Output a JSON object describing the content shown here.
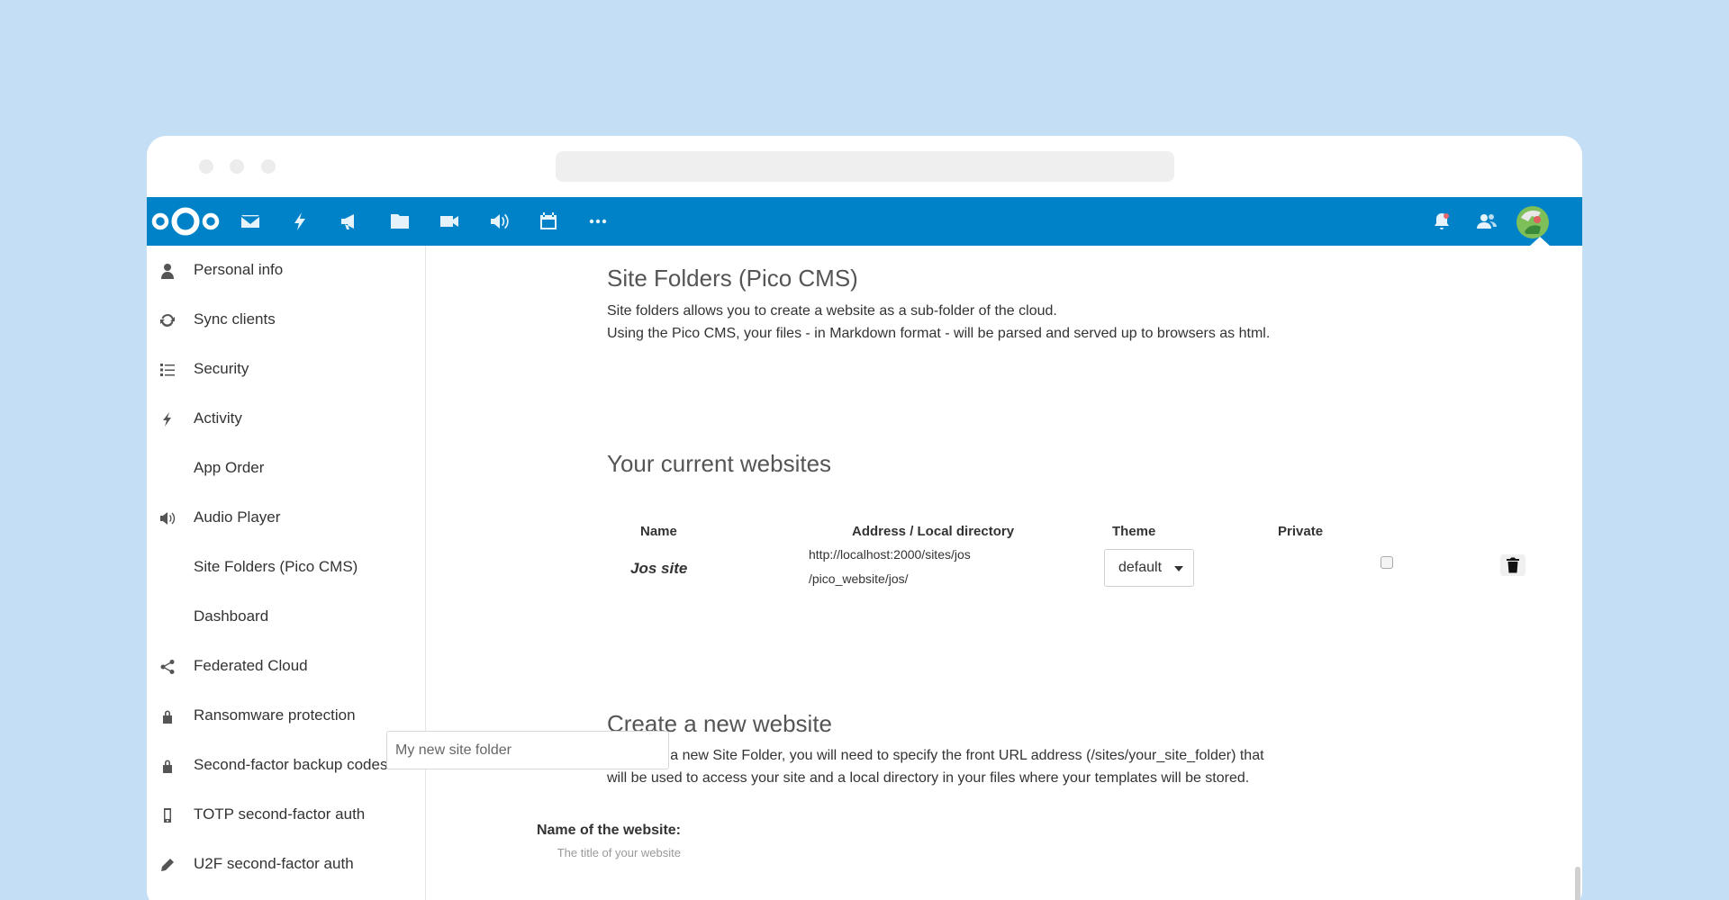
{
  "topbar": {
    "nav_icons": [
      "mail-icon",
      "lightning-icon",
      "megaphone-icon",
      "folder-icon",
      "video-icon",
      "speaker-icon",
      "calendar-icon",
      "more-icon"
    ],
    "right_icons": [
      "bell-icon",
      "contacts-icon",
      "avatar"
    ],
    "color": "#0082c9"
  },
  "sidebar": {
    "items": [
      {
        "label": "Personal info",
        "icon": "person-icon"
      },
      {
        "label": "Sync clients",
        "icon": "sync-icon"
      },
      {
        "label": "Security",
        "icon": "list-icon"
      },
      {
        "label": "Activity",
        "icon": "lightning-icon"
      },
      {
        "label": "App Order",
        "icon": ""
      },
      {
        "label": "Audio Player",
        "icon": "speaker-icon"
      },
      {
        "label": "Site Folders (Pico CMS)",
        "icon": ""
      },
      {
        "label": "Dashboard",
        "icon": ""
      },
      {
        "label": "Federated Cloud",
        "icon": "share-icon"
      },
      {
        "label": "Ransomware protection",
        "icon": "lock-icon"
      },
      {
        "label": "Second-factor backup codes",
        "icon": "lock-icon"
      },
      {
        "label": "TOTP second-factor auth",
        "icon": "phone-icon"
      },
      {
        "label": "U2F second-factor auth",
        "icon": "pencil-icon"
      }
    ]
  },
  "main": {
    "section1": {
      "title": "Site Folders (Pico CMS)",
      "line1": "Site folders allows you to create a website as a sub-folder of the cloud.",
      "line2": "Using the Pico CMS, your files - in Markdown format - will be parsed and served up to browsers as html."
    },
    "section2": {
      "title": "Your current websites",
      "columns": [
        "Name",
        "Address / Local directory",
        "Theme",
        "Private"
      ],
      "row": {
        "name": "Jos site",
        "address_line1": "http://localhost:2000/sites/jos",
        "address_line2": "/pico_website/jos/",
        "theme": "default",
        "private": false
      }
    },
    "section3": {
      "title": "Create a new website",
      "line1": "To create a new Site Folder, you will need to specify the front URL address (/sites/your_site_folder) that",
      "line2": "will be used to access your site and a local directory in your files where your templates will be stored.",
      "name_label": "Name of the website:",
      "name_hint": "The title of your website",
      "name_placeholder": "My new site folder"
    }
  }
}
